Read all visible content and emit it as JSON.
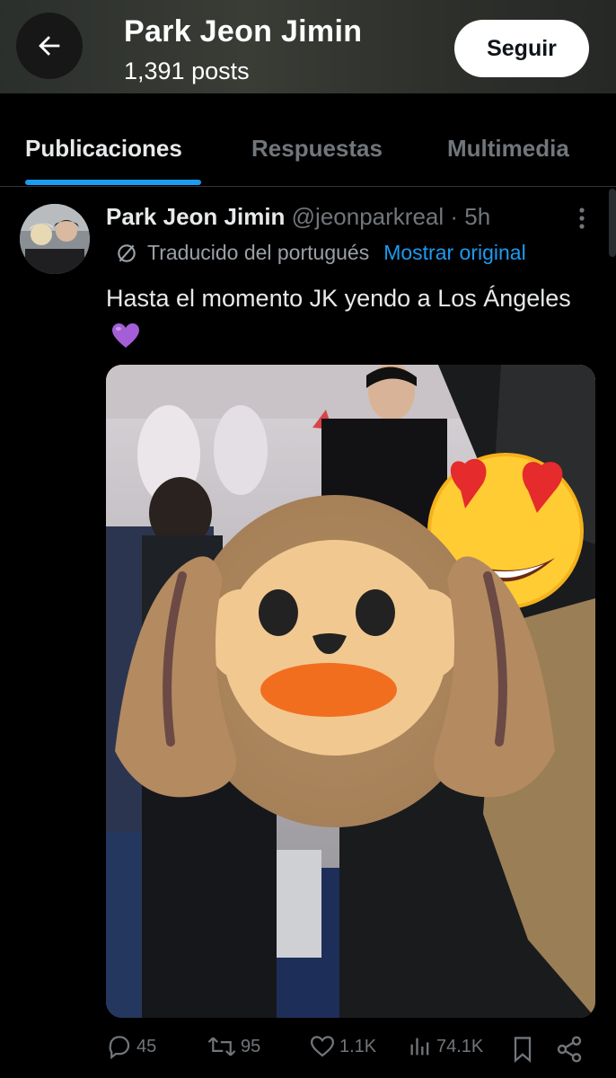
{
  "header": {
    "title": "Park Jeon Jimin",
    "posts_count": "1,391 posts",
    "follow_label": "Seguir"
  },
  "tabs": [
    {
      "label": "Publicaciones",
      "active": true
    },
    {
      "label": "Respuestas",
      "active": false
    },
    {
      "label": "Multimedia",
      "active": false
    }
  ],
  "tweet": {
    "author_name": "Park Jeon Jimin",
    "author_handle": "@jeonparkreal",
    "separator": "·",
    "time": "5h",
    "translated_label": "Traducido del portugués",
    "show_original_label": "Mostrar original",
    "text": "Hasta el momento JK yendo a Los Ángeles",
    "text_emoji": "purple-heart",
    "media_stickers": [
      "see-no-evil-monkey-emoji",
      "heart-eyes-emoji"
    ],
    "stats": {
      "replies": "45",
      "reposts": "95",
      "likes": "1.1K",
      "views": "74.1K"
    }
  },
  "colors": {
    "accent": "#1d9bf0",
    "background": "#000000",
    "muted": "#71767b",
    "text": "#e7e9ea"
  }
}
